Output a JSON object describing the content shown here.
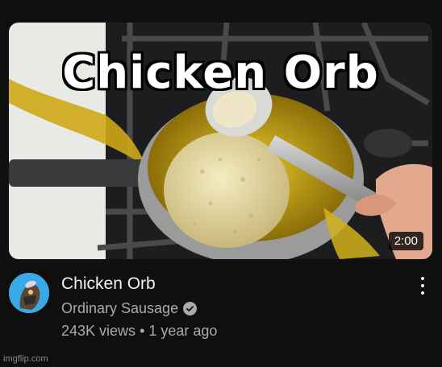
{
  "thumbnail": {
    "overlay_title": "Chicken Orb",
    "duration": "2:00",
    "accent_oil": "#d4b51c",
    "accent_breading": "#e8dca4"
  },
  "video": {
    "title": "Chicken Orb",
    "channel": "Ordinary Sausage",
    "verified_icon": "check-circle-icon",
    "views": "243K views",
    "separator": "•",
    "age": "1 year ago"
  },
  "more_actions_icon": "vertical-dots-icon",
  "watermark": "imgflip.com"
}
